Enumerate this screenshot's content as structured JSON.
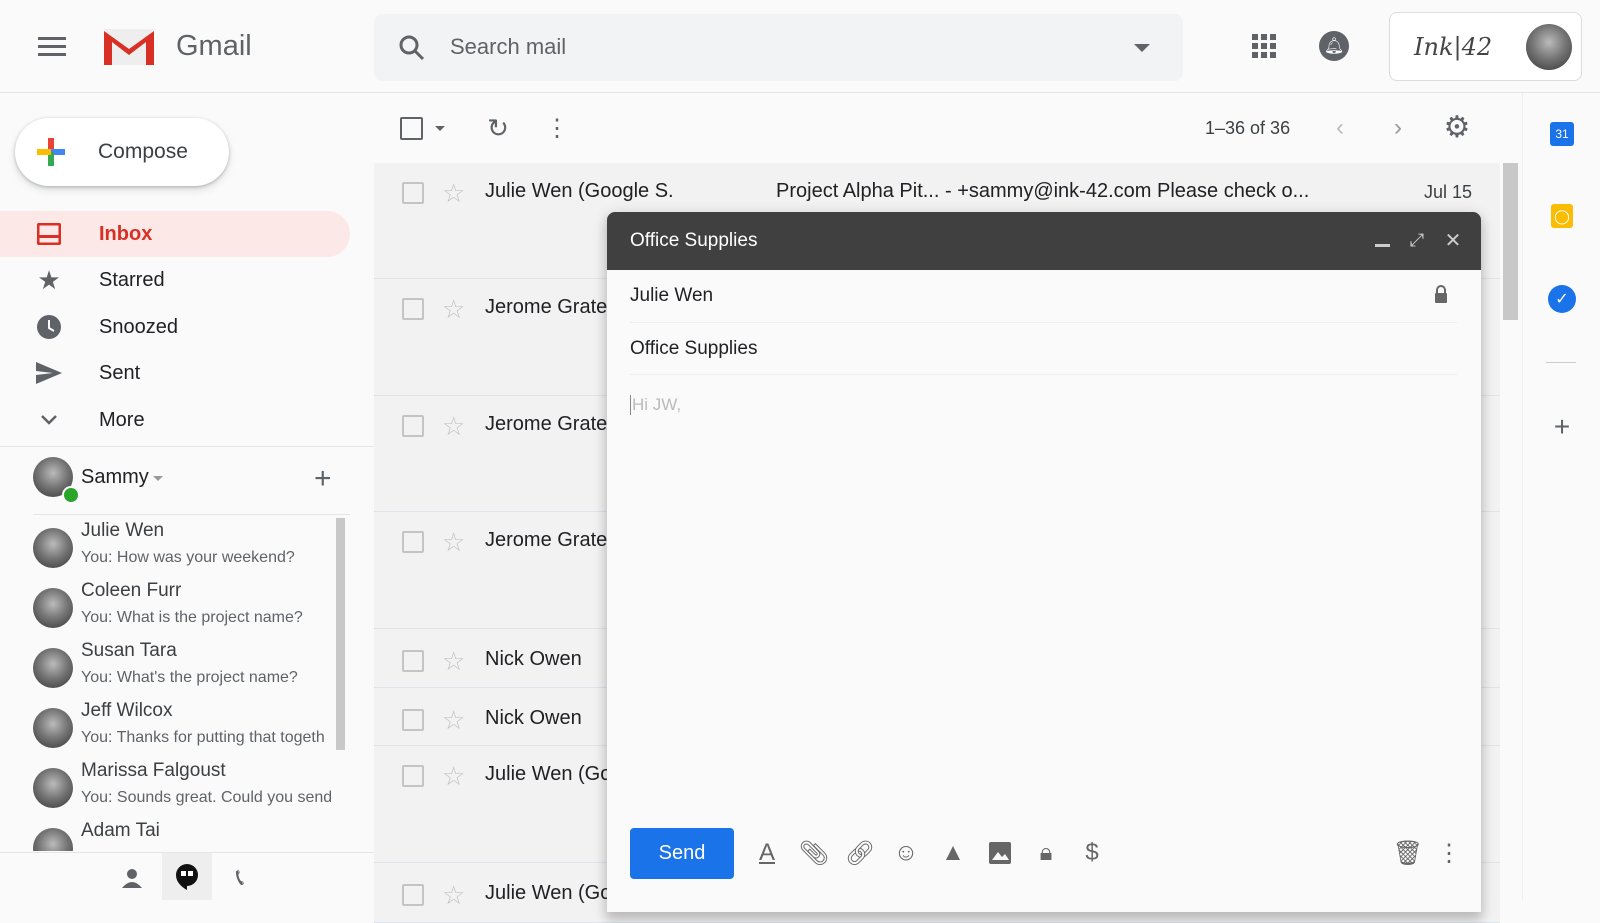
{
  "header": {
    "app_name": "Gmail",
    "search_placeholder": "Search mail",
    "account_brand": "Ink|42"
  },
  "sidebar": {
    "compose_label": "Compose",
    "items": [
      {
        "label": "Inbox",
        "icon": "inbox-icon",
        "active": true
      },
      {
        "label": "Starred",
        "icon": "star-icon"
      },
      {
        "label": "Snoozed",
        "icon": "clock-icon"
      },
      {
        "label": "Sent",
        "icon": "send-icon"
      },
      {
        "label": "More",
        "icon": "chevron-down-icon"
      }
    ],
    "hangouts": {
      "user": "Sammy",
      "status_color": "#2aa52a",
      "chats": [
        {
          "name": "Julie Wen",
          "message": "You: How was your weekend?"
        },
        {
          "name": "Coleen Furr",
          "message": "You: What is the project name?"
        },
        {
          "name": "Susan Tara",
          "message": "You: What's the project name?"
        },
        {
          "name": "Jeff Wilcox",
          "message": "You: Thanks for putting that togeth"
        },
        {
          "name": "Marissa Falgoust",
          "message": "You: Sounds great. Could you send"
        },
        {
          "name": "Adam Tai",
          "message": ""
        }
      ]
    }
  },
  "toolbar": {
    "pagination": "1–36 of 36"
  },
  "emails": [
    {
      "sender": "Julie Wen (Google S.",
      "subject": "Project Alpha Pit... - +sammy@ink-42.com Please check o...",
      "date": "Jul 15"
    },
    {
      "sender": "Jerome Grate",
      "subject": "",
      "date": ""
    },
    {
      "sender": "Jerome Grate",
      "subject": "",
      "date": ""
    },
    {
      "sender": "Jerome Grate",
      "subject": "",
      "date": ""
    },
    {
      "sender": "Nick Owen",
      "subject": "",
      "date": ""
    },
    {
      "sender": "Nick Owen",
      "subject": "",
      "date": ""
    },
    {
      "sender": "Julie Wen (Go",
      "subject": "",
      "date": ""
    },
    {
      "sender": "Julie Wen (Go",
      "subject": "",
      "date": ""
    }
  ],
  "compose": {
    "title": "Office Supplies",
    "to": "Julie Wen",
    "subject": "Office Supplies",
    "body": "Hi JW,",
    "send_label": "Send",
    "accent": "#1a73e8"
  },
  "side_panel": {
    "calendar_day": "31"
  }
}
